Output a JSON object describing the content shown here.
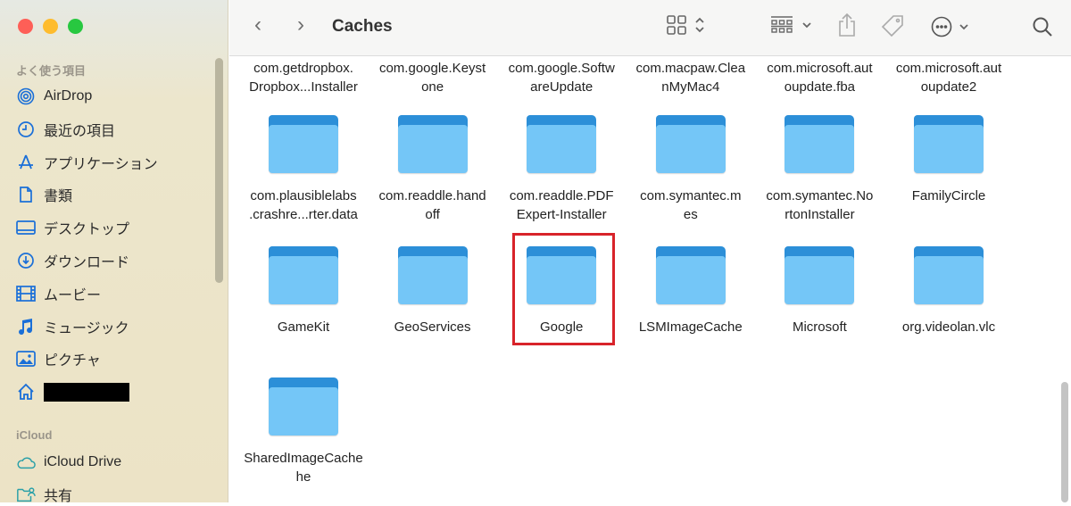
{
  "window": {
    "title": "Caches",
    "traffic_lights": {
      "close": "#fe5f57",
      "minimize": "#febc2e",
      "zoom": "#28c840"
    }
  },
  "sidebar": {
    "favorites_header": "よく使う項目",
    "favorites": [
      {
        "label": "AirDrop",
        "icon": "airdrop-icon"
      },
      {
        "label": "最近の項目",
        "icon": "clock-icon"
      },
      {
        "label": "アプリケーション",
        "icon": "applications-icon"
      },
      {
        "label": "書類",
        "icon": "document-icon"
      },
      {
        "label": "デスクトップ",
        "icon": "desktop-icon"
      },
      {
        "label": "ダウンロード",
        "icon": "download-icon"
      },
      {
        "label": "ムービー",
        "icon": "movie-icon"
      },
      {
        "label": "ミュージック",
        "icon": "music-icon"
      },
      {
        "label": "ピクチャ",
        "icon": "picture-icon"
      },
      {
        "label": "",
        "icon": "home-icon",
        "redacted": true
      }
    ],
    "icloud_header": "iCloud",
    "icloud": [
      {
        "label": "iCloud Drive",
        "icon": "cloud-icon"
      },
      {
        "label": "共有",
        "icon": "shared-folder-icon"
      }
    ]
  },
  "toolbar": {
    "icons": [
      "back-icon",
      "forward-icon",
      "grid-view-icon",
      "group-icon",
      "share-icon",
      "tag-icon",
      "more-icon",
      "search-icon"
    ]
  },
  "files": {
    "row1": [
      [
        "com.getdropbox.",
        "Dropbox...Installer"
      ],
      [
        "com.google.Keyst",
        "one"
      ],
      [
        "com.google.Softw",
        "areUpdate"
      ],
      [
        "com.macpaw.Clea",
        "nMyMac4"
      ],
      [
        "com.microsoft.aut",
        "oupdate.fba"
      ],
      [
        "com.microsoft.aut",
        "oupdate2"
      ]
    ],
    "row2": [
      [
        "com.plausiblelabs",
        ".crashre...rter.data"
      ],
      [
        "com.readdle.hand",
        "off"
      ],
      [
        "com.readdle.PDF",
        "Expert-Installer"
      ],
      [
        "com.symantec.m",
        "es"
      ],
      [
        "com.symantec.No",
        "rtonInstaller"
      ],
      [
        "FamilyCircle"
      ]
    ],
    "row3": [
      [
        "GameKit"
      ],
      [
        "GeoServices"
      ],
      [
        "Google"
      ],
      [
        "LSMImageCache"
      ],
      [
        "Microsoft"
      ],
      [
        "org.videolan.vlc"
      ]
    ],
    "row4": [
      [
        "SharedImageCache",
        "he"
      ]
    ]
  },
  "highlight": {
    "item": "Google",
    "color": "#d8232a"
  }
}
